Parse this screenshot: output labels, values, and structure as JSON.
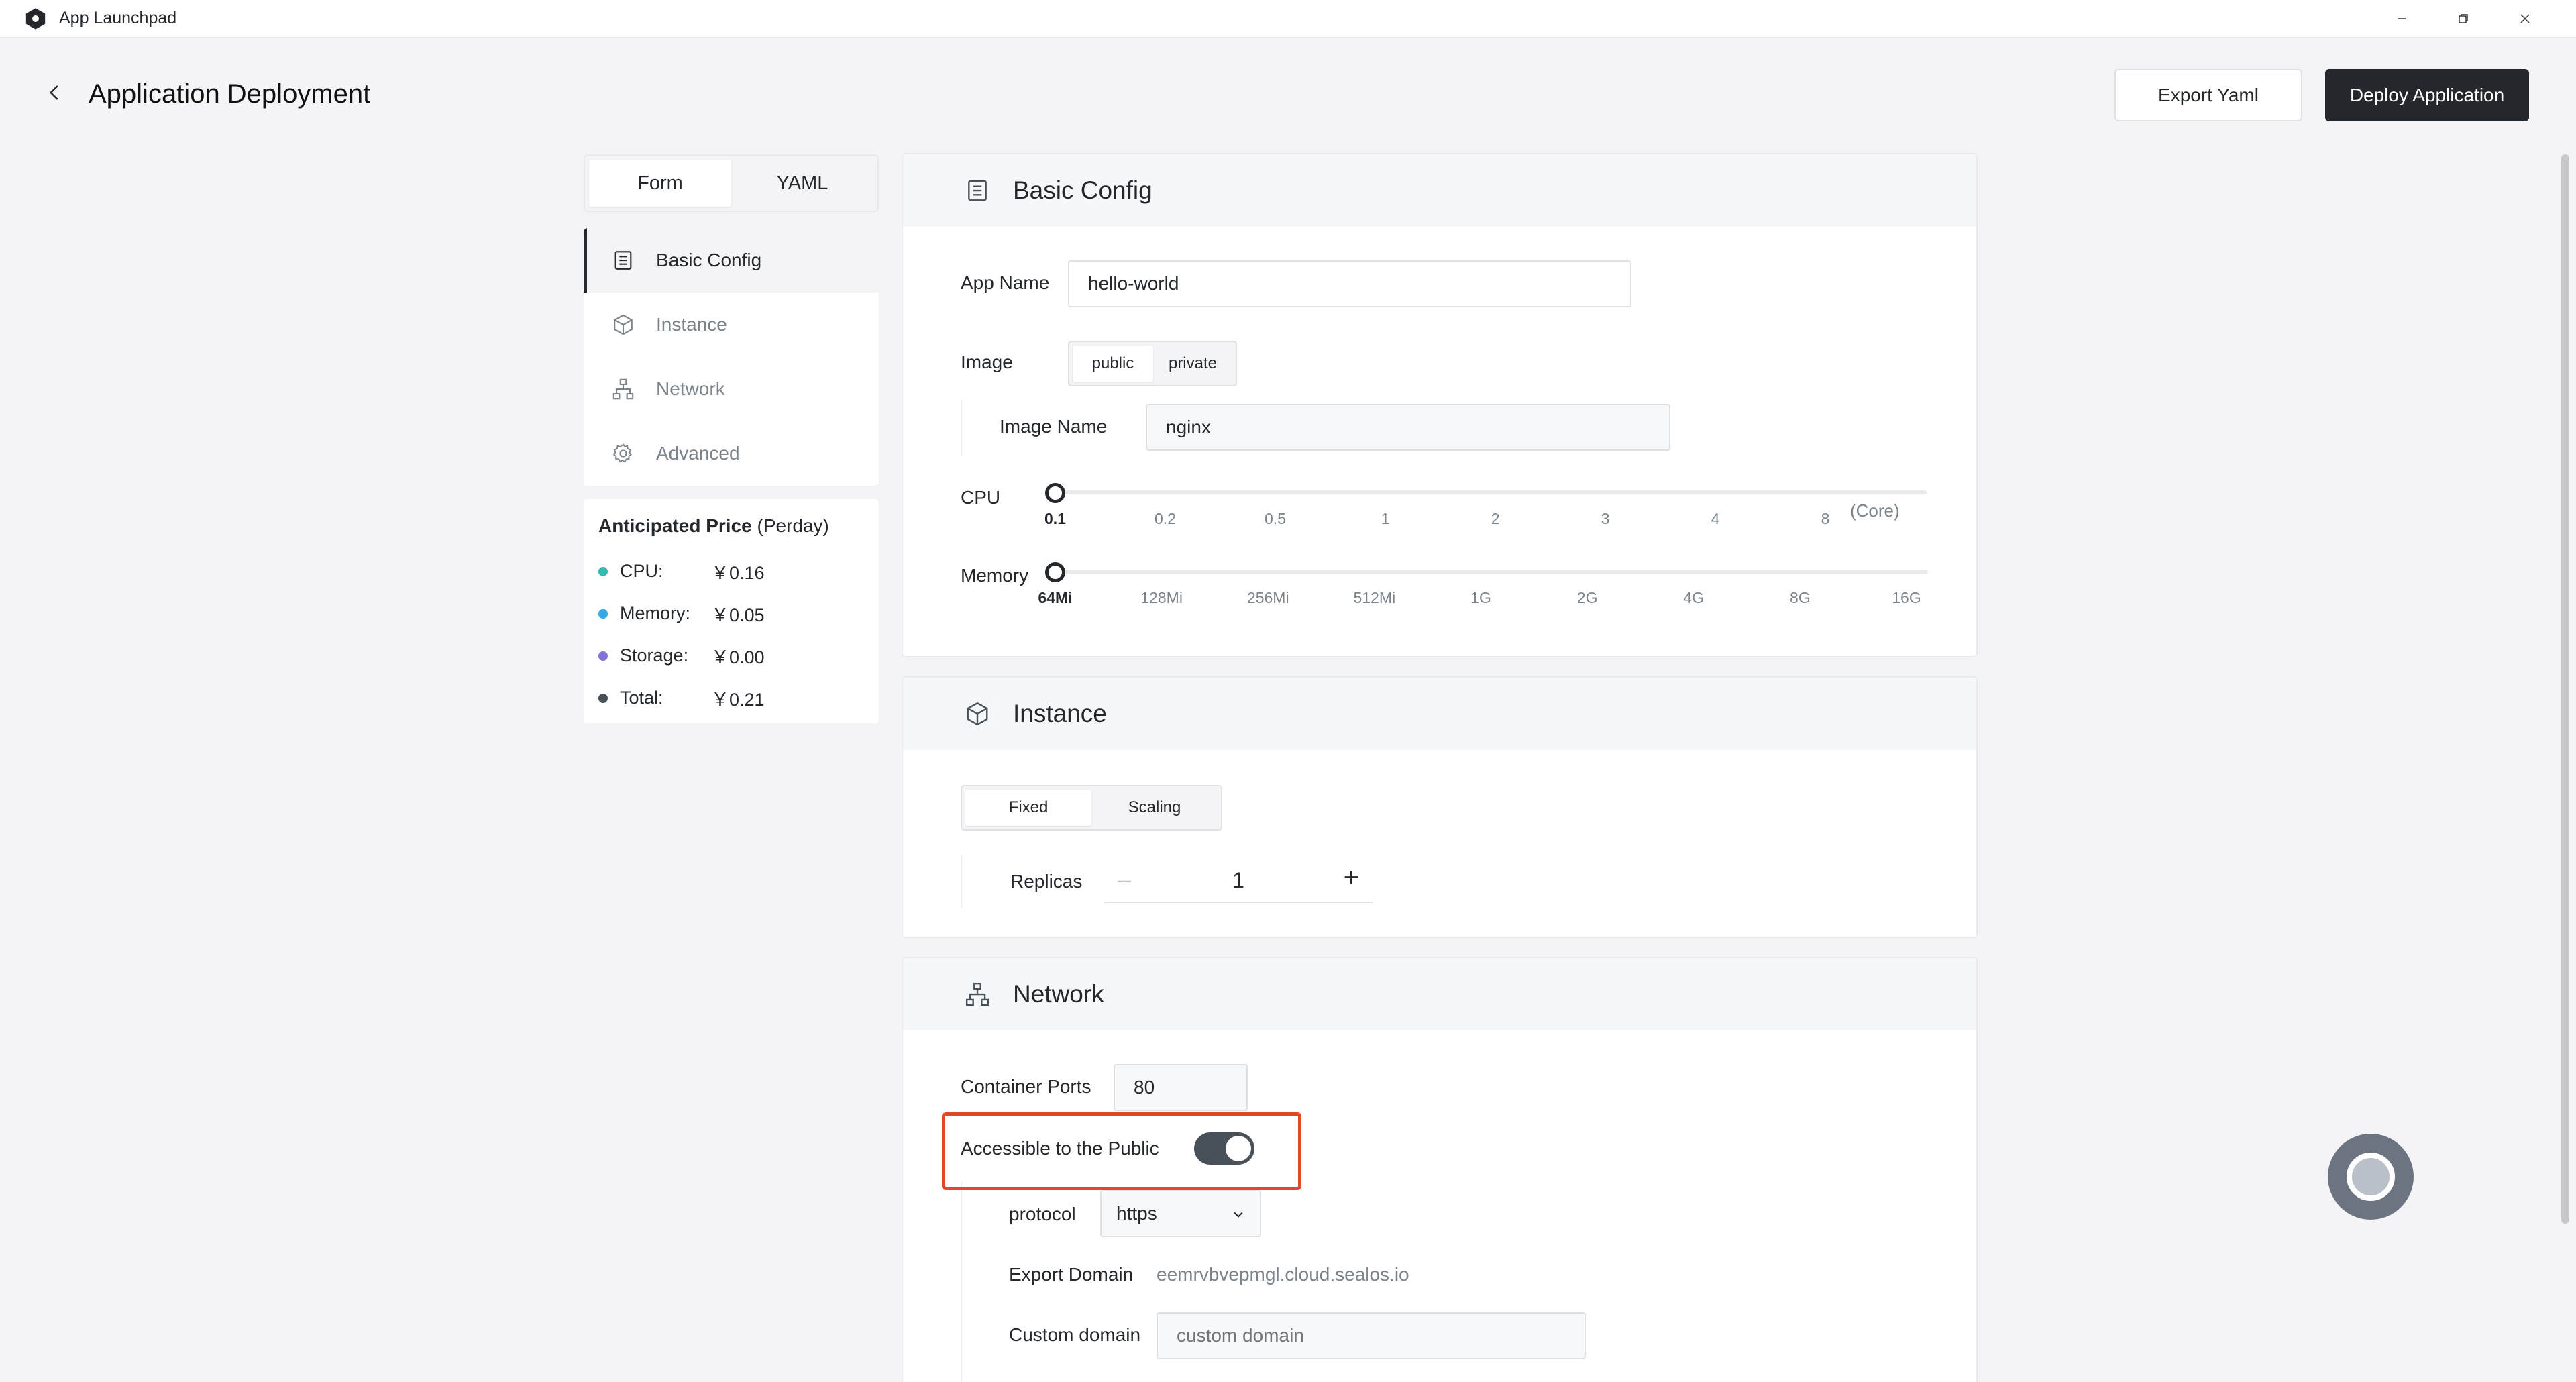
{
  "window": {
    "title": "App Launchpad"
  },
  "header": {
    "title": "Application Deployment",
    "export_label": "Export Yaml",
    "deploy_label": "Deploy Application"
  },
  "sidebar": {
    "tabs": [
      {
        "label": "Form",
        "active": true
      },
      {
        "label": "YAML",
        "active": false
      }
    ],
    "nav": [
      {
        "label": "Basic Config",
        "icon": "document-icon",
        "active": true
      },
      {
        "label": "Instance",
        "icon": "cube-icon",
        "active": false
      },
      {
        "label": "Network",
        "icon": "network-icon",
        "active": false
      },
      {
        "label": "Advanced",
        "icon": "gear-icon",
        "active": false
      }
    ],
    "price": {
      "title": "Anticipated Price",
      "period": "(Perday)",
      "rows": [
        {
          "label": "CPU:",
          "value": "￥0.16",
          "color": "#33bbb0"
        },
        {
          "label": "Memory:",
          "value": "￥0.05",
          "color": "#36a9e1"
        },
        {
          "label": "Storage:",
          "value": "￥0.00",
          "color": "#8172d8"
        },
        {
          "label": "Total:",
          "value": "￥0.21",
          "color": "#485058"
        }
      ]
    }
  },
  "basic": {
    "title": "Basic Config",
    "app_name_label": "App Name",
    "app_name_value": "hello-world",
    "image_label": "Image",
    "image_options": [
      {
        "label": "public",
        "active": true
      },
      {
        "label": "private",
        "active": false
      }
    ],
    "image_name_label": "Image Name",
    "image_name_value": "nginx",
    "cpu_label": "CPU",
    "cpu_ticks": [
      "0.1",
      "0.2",
      "0.5",
      "1",
      "2",
      "3",
      "4",
      "8"
    ],
    "cpu_selected": "0.1",
    "cpu_unit": "(Core)",
    "memory_label": "Memory",
    "memory_ticks": [
      "64Mi",
      "128Mi",
      "256Mi",
      "512Mi",
      "1G",
      "2G",
      "4G",
      "8G",
      "16G"
    ],
    "memory_selected": "64Mi"
  },
  "instance": {
    "title": "Instance",
    "modes": [
      {
        "label": "Fixed",
        "active": true
      },
      {
        "label": "Scaling",
        "active": false
      }
    ],
    "replicas_label": "Replicas",
    "replicas_value": "1"
  },
  "network": {
    "title": "Network",
    "ports_label": "Container Ports",
    "ports_value": "80",
    "public_label": "Accessible to the Public",
    "public_enabled": true,
    "protocol_label": "protocol",
    "protocol_value": "https",
    "domain_label": "Export Domain",
    "domain_value": "eemrvbvepmgl.cloud.sealos.io",
    "custom_domain_label": "Custom domain",
    "custom_domain_placeholder": "custom domain"
  }
}
